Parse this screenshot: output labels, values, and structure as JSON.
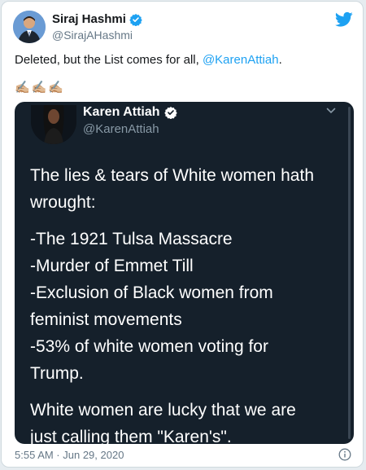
{
  "author": {
    "display_name": "Siraj Hashmi",
    "handle": "@SirajAHashmi",
    "verified_icon": "verified-badge-icon"
  },
  "tweet": {
    "text_before": "Deleted, but the List comes for all, ",
    "mention": "@KarenAttiah",
    "text_after": ".",
    "emojis": "✍🏼✍🏼✍🏼",
    "timestamp": "5:55 AM · Jun 29, 2020"
  },
  "quoted": {
    "display_name": "Karen Attiah",
    "handle": "@KarenAttiah",
    "paragraph1": [
      "The lies & tears of White women hath",
      "wrought:"
    ],
    "list_lines": [
      "-The 1921 Tulsa Massacre",
      "-Murder of Emmet Till",
      "-Exclusion of Black women from",
      "feminist movements",
      "-53% of white women voting for",
      "Trump."
    ],
    "closing": [
      "White women are lucky that we are",
      "just calling them \"Karen's\"."
    ]
  },
  "colors": {
    "twitter_blue": "#1da1f2",
    "dark_bg": "#15202b"
  }
}
